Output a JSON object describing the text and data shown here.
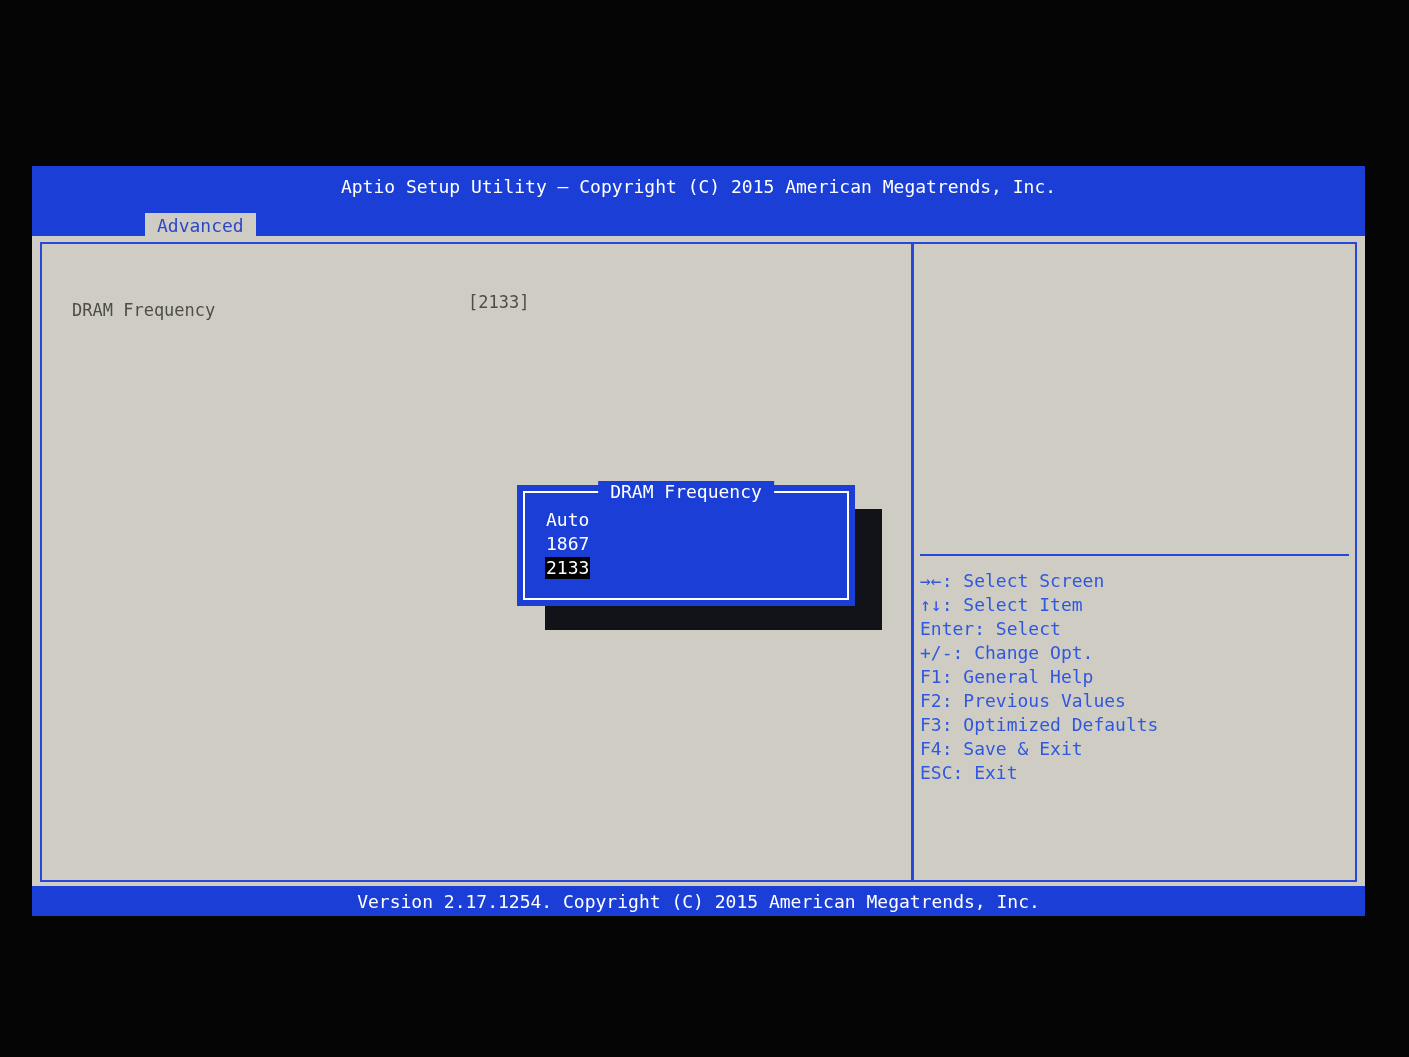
{
  "title_bar": {
    "title": "Aptio Setup Utility – Copyright (C) 2015 American Megatrends, Inc."
  },
  "tabs": [
    {
      "label": "Advanced",
      "selected": true
    }
  ],
  "settings": [
    {
      "label": "DRAM Frequency",
      "value": "[2133]"
    }
  ],
  "help_keys": [
    "→←: Select Screen",
    "↑↓: Select Item",
    "Enter: Select",
    "+/-: Change Opt.",
    "F1: General Help",
    "F2: Previous Values",
    "F3: Optimized Defaults",
    "F4: Save & Exit",
    "ESC: Exit"
  ],
  "popup": {
    "title": "DRAM Frequency",
    "options": [
      {
        "label": "Auto",
        "selected": false
      },
      {
        "label": "1867",
        "selected": false
      },
      {
        "label": "2133",
        "selected": true
      }
    ]
  },
  "footer": {
    "text": "Version 2.17.1254. Copyright (C) 2015 American Megatrends, Inc."
  }
}
